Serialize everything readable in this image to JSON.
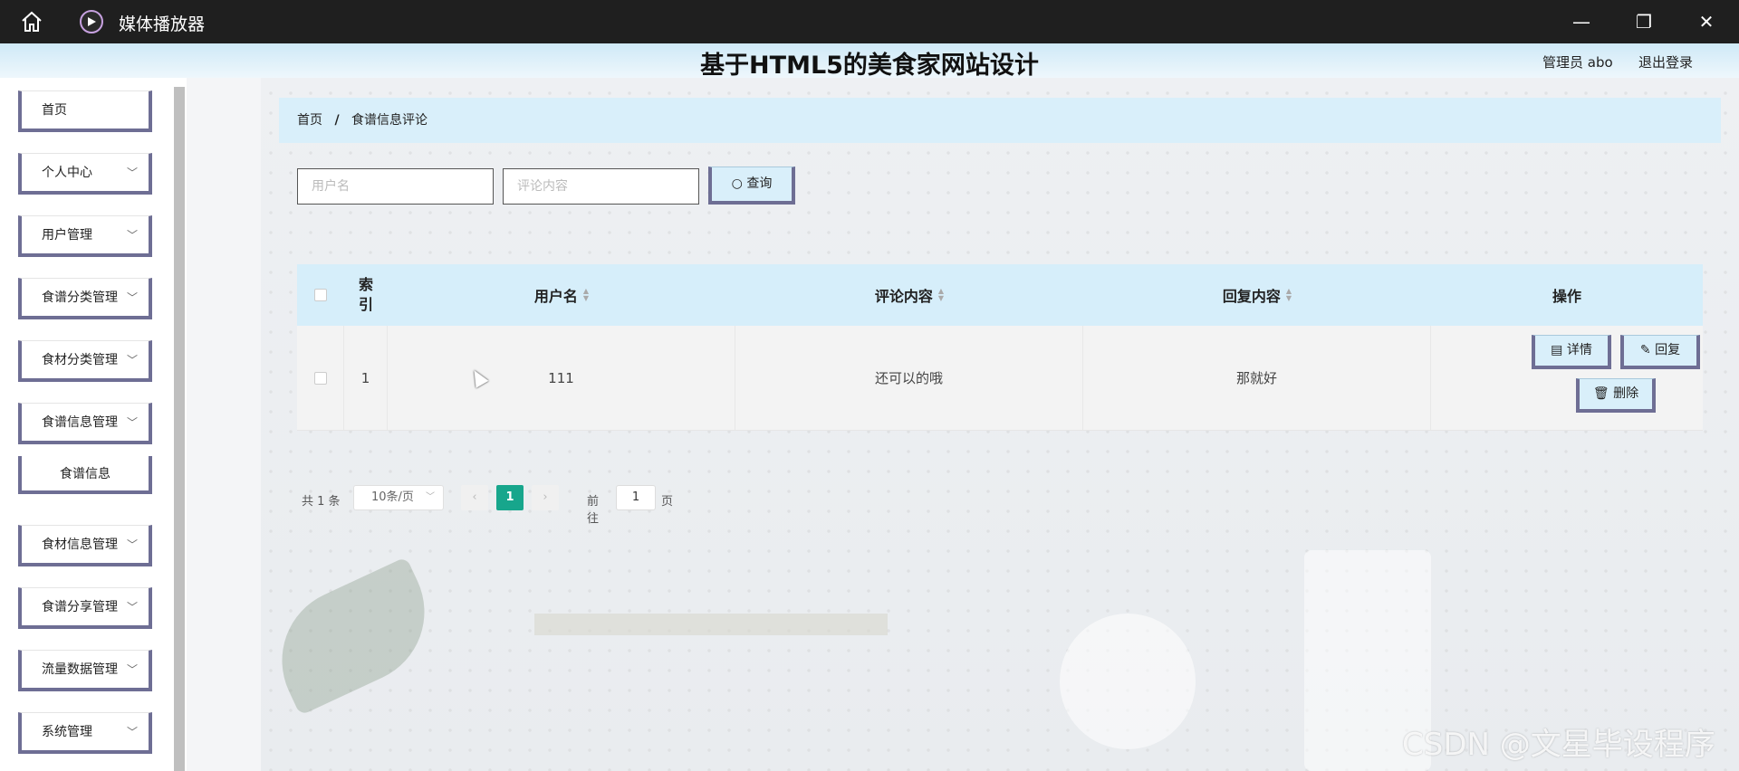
{
  "window": {
    "title": "媒体播放器",
    "minimize": "—",
    "maximize": "❐",
    "close": "✕"
  },
  "header": {
    "site_title": "基于HTML5的美食家网站设计",
    "user_info": "管理员 abo",
    "logout": "退出登录"
  },
  "sidebar": {
    "items": [
      {
        "label": "首页",
        "chev": ""
      },
      {
        "label": "个人中心",
        "chev": "﹀"
      },
      {
        "label": "用户管理",
        "chev": "﹀"
      },
      {
        "label": "食谱分类管理",
        "chev": "﹀"
      },
      {
        "label": "食材分类管理",
        "chev": "﹀"
      },
      {
        "label": "食谱信息管理",
        "chev": "﹀"
      },
      {
        "label": "食材信息管理",
        "chev": "﹀"
      },
      {
        "label": "食谱分享管理",
        "chev": "﹀"
      },
      {
        "label": "流量数据管理",
        "chev": "﹀"
      },
      {
        "label": "系统管理",
        "chev": "﹀"
      }
    ],
    "sub_item": "食谱信息"
  },
  "breadcrumb": {
    "home": "首页",
    "separator": "/",
    "current": "食谱信息评论"
  },
  "search": {
    "username_placeholder": "用户名",
    "comment_placeholder": "评论内容",
    "button_label": "查询"
  },
  "table": {
    "headers": {
      "index": "索引",
      "username": "用户名",
      "comment": "评论内容",
      "reply": "回复内容",
      "actions": "操作"
    },
    "rows": [
      {
        "index": "1",
        "username": "111",
        "comment": "还可以的哦",
        "reply": "那就好"
      }
    ],
    "actions": {
      "detail": "详情",
      "reply": "回复",
      "delete": "删除"
    }
  },
  "pagination": {
    "total": "共 1 条",
    "page_size": "10条/页",
    "prev": "‹",
    "current_page": "1",
    "next": "›",
    "goto_label": "前往",
    "goto_value": "1",
    "goto_unit": "页"
  },
  "watermark": "CSDN @文星毕设程序",
  "colors": {
    "accent_border": "#6e6e94",
    "header_bg": "#d9effa",
    "active_page": "#17a68c"
  }
}
